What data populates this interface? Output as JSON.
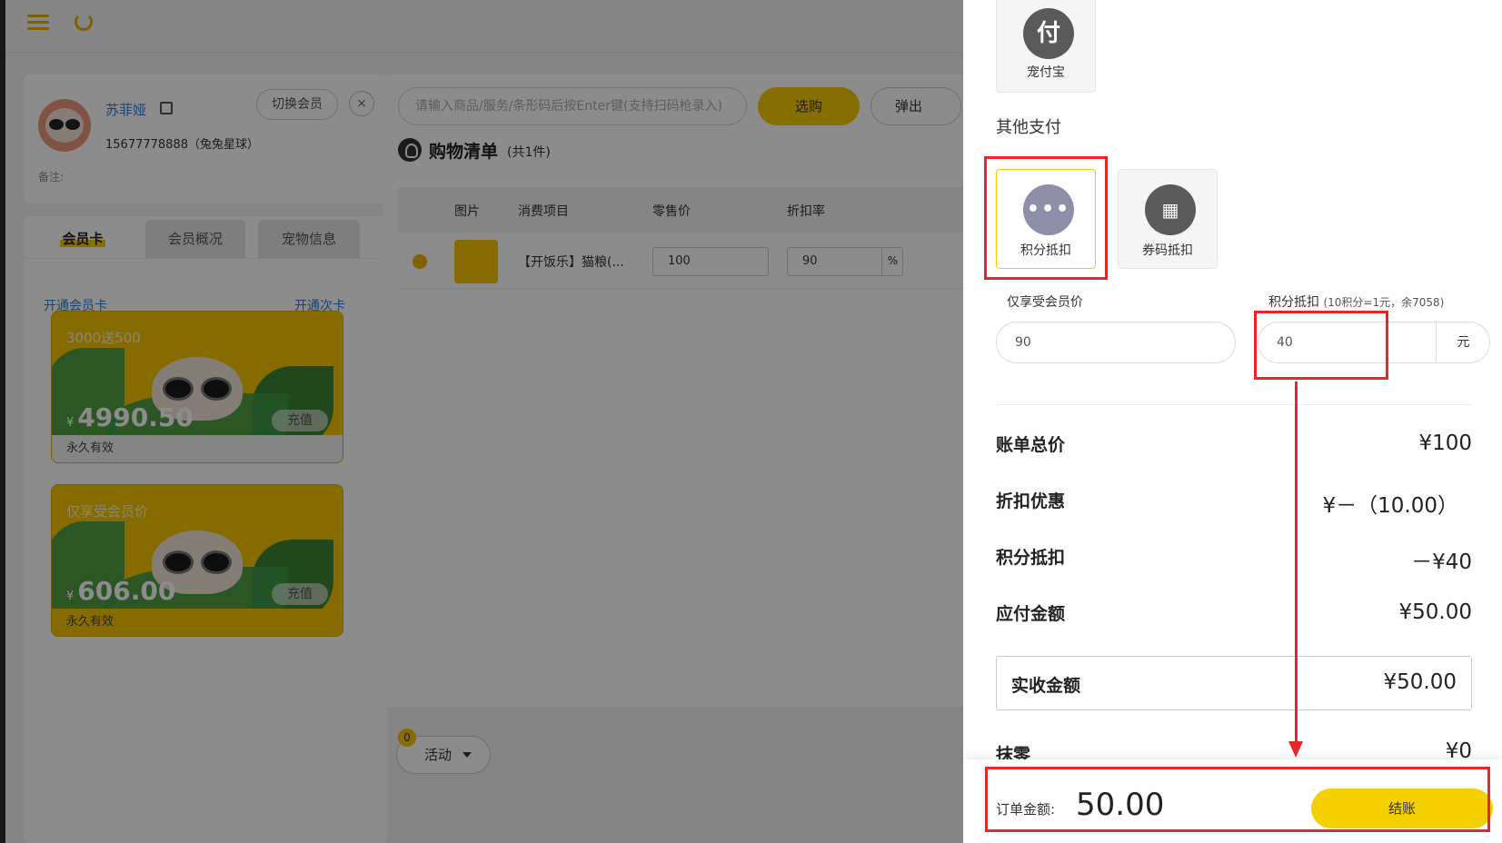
{
  "member": {
    "name": "苏菲娅",
    "switch_label": "切换会员",
    "close": "×",
    "phone": "15677778888（兔兔星球）",
    "note_label": "备注:"
  },
  "tabs": [
    {
      "label": "会员卡"
    },
    {
      "label": "会员概况"
    },
    {
      "label": "宠物信息"
    }
  ],
  "links": {
    "open_member_card": "开通会员卡",
    "open_times_card": "开通次卡"
  },
  "cards": [
    {
      "title": "3000送500",
      "currency": "¥",
      "amount": "4990.50",
      "charge": "充值",
      "valid": "永久有效"
    },
    {
      "title": "仅享受会员价",
      "currency": "¥",
      "amount": "606.00",
      "charge": "充值",
      "valid": "永久有效"
    }
  ],
  "search": {
    "placeholder": "请输入商品/服务/条形码后按Enter键(支持扫码枪录入)"
  },
  "buttons": {
    "select": "选购",
    "popup": "弹出",
    "activity": "活动",
    "activity_badge": "0"
  },
  "cart": {
    "title": "购物清单",
    "count": "(共1件)",
    "columns": [
      "图片",
      "消费项目",
      "零售价",
      "折扣率"
    ],
    "rows": [
      {
        "name": "【开饭乐】猫粮(...",
        "price": "100",
        "discount": "90",
        "discount_unit": "%"
      }
    ]
  },
  "drawer": {
    "top_tile": {
      "glyph": "付",
      "label": "宠付宝"
    },
    "other_title": "其他支付",
    "other_tiles": [
      {
        "label": "积分抵扣",
        "icon": "more-dots-icon",
        "selected": true
      },
      {
        "label": "券码抵扣",
        "icon": "coupon-icon",
        "selected": false
      }
    ],
    "member_price_label": "仅享受会员价",
    "member_price_value": "90",
    "points_label": "积分抵扣",
    "points_hint": "(10积分=1元，余7058)",
    "points_value": "40",
    "points_unit": "元",
    "summary": [
      {
        "label": "账单总价",
        "value": "¥100"
      },
      {
        "label": "折扣优惠",
        "value": "¥－（10.00）"
      },
      {
        "label": "积分抵扣",
        "value": "－¥40"
      },
      {
        "label": "应付金额",
        "value": "¥50.00"
      }
    ],
    "received_label": "实收金额",
    "received_value": "¥50.00",
    "rounding_label": "抹零",
    "rounding_value": "¥0",
    "order_label": "订单金额:",
    "order_amount": "50.00",
    "checkout": "结账"
  },
  "colors": {
    "accent": "#f5c800",
    "annotation": "#e8262a",
    "link": "#2e7bd6"
  }
}
